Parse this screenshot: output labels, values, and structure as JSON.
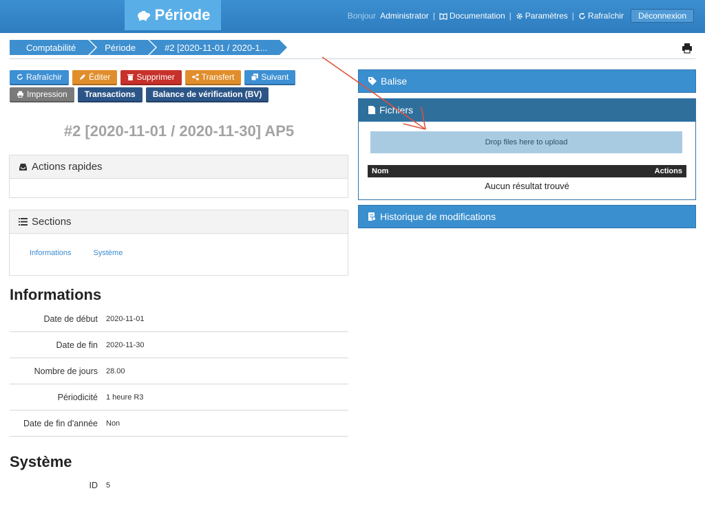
{
  "header": {
    "brand": "Période",
    "greeting": "Bonjour",
    "user": "Administrator",
    "links": [
      "Documentation",
      "Paramètres",
      "Rafraîchir"
    ],
    "logout": "Déconnexion"
  },
  "breadcrumb": [
    "Comptabilité",
    "Période",
    "#2 [2020-11-01 / 2020-1..."
  ],
  "toolbar": {
    "refresh": "Rafraîchir",
    "edit": "Éditer",
    "delete": "Supprimer",
    "transfer": "Transfert",
    "next": "Suivant",
    "print": "Impression",
    "transactions": "Transactions",
    "trial_balance": "Balance de vérification (BV)"
  },
  "page_title": "#2 [2020-11-01 / 2020-11-30] AP5",
  "quick_actions": {
    "title": "Actions rapides"
  },
  "sections": {
    "title": "Sections",
    "links": [
      "Informations",
      "Système"
    ]
  },
  "informations": {
    "title": "Informations",
    "rows": [
      {
        "key": "Date de début",
        "value": "2020-11-01"
      },
      {
        "key": "Date de fin",
        "value": "2020-11-30"
      },
      {
        "key": "Nombre de jours",
        "value": "28.00"
      },
      {
        "key": "Périodicité",
        "value": "1 heure R3"
      },
      {
        "key": "Date de fin d'année",
        "value": "Non"
      }
    ]
  },
  "systeme": {
    "title": "Système",
    "rows": [
      {
        "key": "ID",
        "value": "5"
      }
    ]
  },
  "right": {
    "tag_title": "Balise",
    "files_title": "Fichiers",
    "dropzone": "Drop files here to upload",
    "col_name": "Nom",
    "col_actions": "Actions",
    "empty": "Aucun résultat trouvé",
    "history_title": "Historique de modifications"
  },
  "colors": {
    "primary": "#3a8fcf",
    "navy": "#2c5587",
    "orange": "#e08e2c",
    "red": "#c7312b",
    "annotation": "#e0513a"
  }
}
